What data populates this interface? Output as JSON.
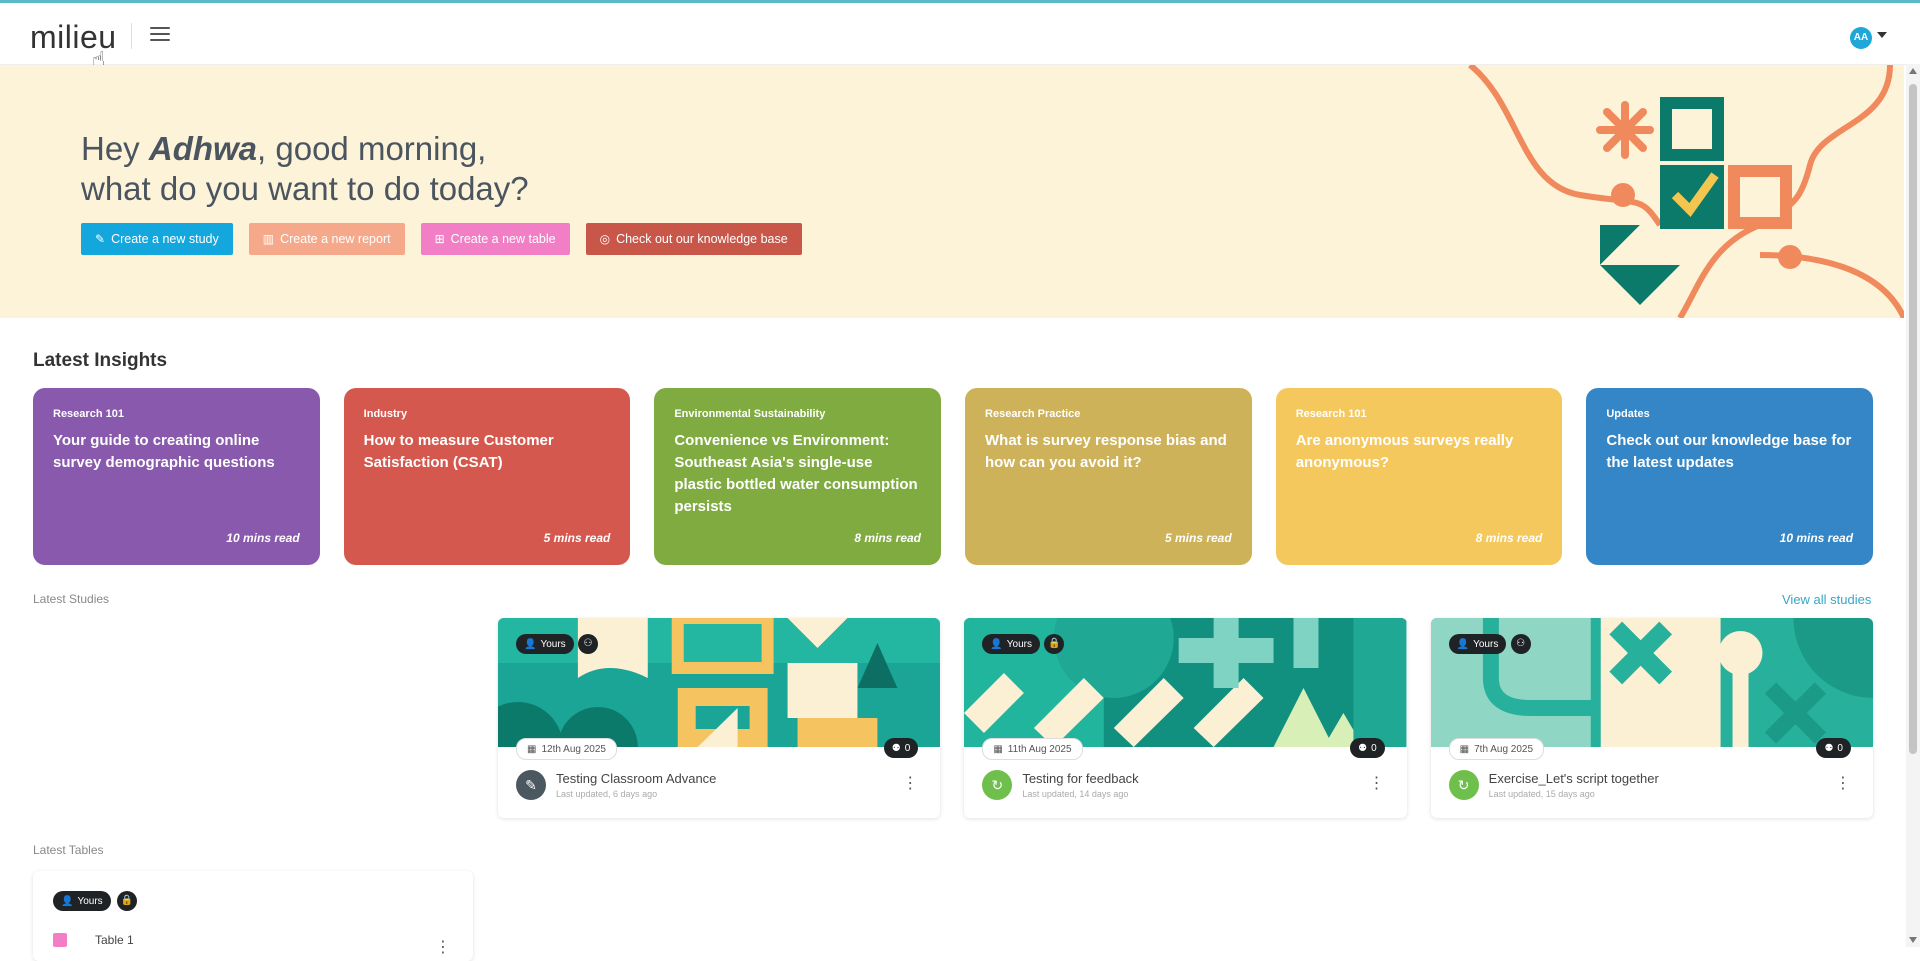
{
  "header": {
    "logo_text": "milieu",
    "avatar_initials": "AA"
  },
  "hero": {
    "greeting_prefix": "Hey ",
    "user_name": "Adhwa",
    "greeting_suffix": ", good morning,",
    "greeting_line2": "what do you want to do today?",
    "buttons": [
      {
        "label": "Create a new study",
        "color": "#13a7dd",
        "icon": "study-icon"
      },
      {
        "label": "Create a new report",
        "color": "#f6a98a",
        "icon": "report-icon"
      },
      {
        "label": "Create a new table",
        "color": "#f27fc6",
        "icon": "table-icon"
      },
      {
        "label": "Check out our knowledge base",
        "color": "#c8574a",
        "icon": "lightbulb-icon"
      }
    ]
  },
  "insights": {
    "title": "Latest Insights",
    "cards": [
      {
        "category": "Research 101",
        "title": "Your guide to creating online survey demographic questions",
        "read": "10 mins read",
        "color": "#8859ac"
      },
      {
        "category": "Industry",
        "title": "How to measure Customer Satisfaction (CSAT)",
        "read": "5 mins read",
        "color": "#d5584e"
      },
      {
        "category": "Environmental Sustainability",
        "title": "Convenience vs Environment: Southeast Asia's single-use plastic bottled water consumption persists",
        "read": "8 mins read",
        "color": "#7fab41"
      },
      {
        "category": "Research Practice",
        "title": "What is survey response bias and how can you avoid it?",
        "read": "5 mins read",
        "color": "#cdb25a"
      },
      {
        "category": "Research 101",
        "title": "Are anonymous surveys really anonymous?",
        "read": "8 mins read",
        "color": "#f5c85e"
      },
      {
        "category": "Updates",
        "title": "Check out our knowledge base for the latest updates",
        "read": "10 mins read",
        "color": "#3486c6"
      }
    ]
  },
  "studies": {
    "title": "Latest Studies",
    "view_all": "View all studies",
    "cards": [
      {
        "badge": "Yours",
        "date": "12th Aug 2025",
        "count": "0",
        "name": "Testing Classroom Advance",
        "updated": "Last updated, 6 days ago",
        "status_icon": "pencil-icon",
        "status_color": "#4c5860"
      },
      {
        "badge": "Yours",
        "date": "11th Aug 2025",
        "count": "0",
        "name": "Testing for feedback",
        "updated": "Last updated, 14 days ago",
        "status_icon": "refresh-icon",
        "status_color": "#6fbf4d"
      },
      {
        "badge": "Yours",
        "date": "7th Aug 2025",
        "count": "0",
        "name": "Exercise_Let's script together",
        "updated": "Last updated, 15 days ago",
        "status_icon": "refresh-icon",
        "status_color": "#6fbf4d"
      }
    ]
  },
  "tables": {
    "title": "Latest Tables",
    "cards": [
      {
        "badge": "Yours",
        "name": "Table 1"
      }
    ]
  }
}
